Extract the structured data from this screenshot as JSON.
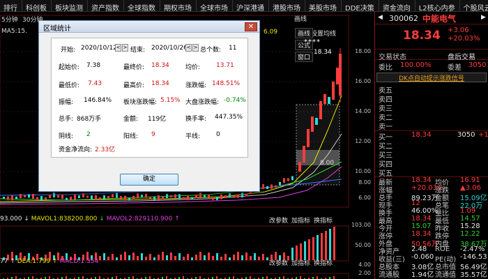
{
  "topbar": {
    "items": [
      "排行",
      "科创板",
      "板块监测",
      "资产指数",
      "全球指数",
      "期权市场",
      "全球市场",
      "沪深港通",
      "港股市场",
      "美股市场",
      "DDE决策",
      "资金流向",
      "L2核心内参",
      "个股风云"
    ]
  },
  "chart": {
    "period_label": "5分钟",
    "period_label_2": "30分钟",
    "ma5_label": "MA5:15.",
    "top_value": "6.09",
    "settings_label": "设置均线",
    "tabs": [
      "画线",
      "公式",
      "窗口"
    ],
    "peak_label": "18.34",
    "stars": "****",
    "range_label": "8.00",
    "price_ticks": [
      "18.00",
      "16.00",
      "14.00",
      "12.00",
      "10.00",
      "8.00",
      "6.00"
    ],
    "vol_line": {
      "prefix": "93.000",
      "mavol1_label": "MAVOL1:838200.800",
      "mavol2_label": "MAVOL2:829110.900"
    },
    "vol_buttons": [
      "改参数",
      "加指标",
      "换指标"
    ],
    "vol_ticks": [
      "103.00",
      "50.00"
    ],
    "macd_line": {
      "prefix": "77",
      "dea_label": "DEA:1.799",
      "macd_label": "MACD:1.354"
    },
    "macd_buttons": [
      "改参数",
      "加指标",
      "换指标"
    ],
    "macd_ticks": [
      "4.00",
      "2.00"
    ]
  },
  "dialog": {
    "title": "区域统计",
    "close": "✕",
    "start_label": "开始:",
    "start_value": "2020/10/12",
    "end_label": "结束:",
    "end_value": "2020/10/26",
    "count_label": "总个数:",
    "count_value": "11",
    "open_label": "起始价:",
    "open_value": "7.38",
    "last_label": "最终价:",
    "last_value": "18.34",
    "avg_label": "均价:",
    "avg_value": "13.71",
    "low_label": "最低价:",
    "low_value": "7.43",
    "high_label": "最高价:",
    "high_value": "18.34",
    "chg_label": "涨跌幅:",
    "chg_value": "148.51%",
    "amp_label": "振幅:",
    "amp_value": "146.84%",
    "sector_label": "板块涨跌幅:",
    "sector_value": "5.15%",
    "market_label": "大盘涨跌幅:",
    "market_value": "-0.74%",
    "vol_label": "总手:",
    "vol_value": "868万手",
    "amt_label": "金额:",
    "amt_value": "119亿",
    "turn_label": "换手率:",
    "turn_value": "447.35%",
    "yin_label": "阴线:",
    "yin_value": "2",
    "yang_label": "阳线:",
    "yang_value": "9",
    "flat_label": "平线:",
    "flat_value": "0",
    "flow_label": "资金净流向:",
    "flow_value": "2.33亿",
    "ok_label": "确定"
  },
  "quote": {
    "code": "300062",
    "name": "中能电气",
    "price": "18.34",
    "change": "+3.06",
    "change_pct": "+20.03%",
    "state_label": "交易状态",
    "state_value": "盘后交易",
    "bid_ratio_label": "委比",
    "bid_ratio_value": "100.00%",
    "bid_diff_label": "委差",
    "bid_diff_value": "3050",
    "banner": "DK点自动提示涨跌信号",
    "asks": [
      {
        "label": "卖五",
        "price": "",
        "vol": ""
      },
      {
        "label": "卖四",
        "price": "",
        "vol": ""
      },
      {
        "label": "卖三",
        "price": "",
        "vol": ""
      },
      {
        "label": "卖二",
        "price": "",
        "vol": ""
      },
      {
        "label": "卖一",
        "price": "",
        "vol": ""
      }
    ],
    "bids": [
      {
        "label": "买一",
        "price": "18.34",
        "vol": "3050",
        "chg": "+1"
      },
      {
        "label": "买二",
        "price": "",
        "vol": "",
        "chg": ""
      },
      {
        "label": "买三",
        "price": "",
        "vol": "",
        "chg": ""
      },
      {
        "label": "买四",
        "price": "",
        "vol": "",
        "chg": ""
      },
      {
        "label": "买五",
        "price": "",
        "vol": "",
        "chg": ""
      }
    ],
    "stats": [
      {
        "l1": "最新",
        "v1": "18.34",
        "c1": "red",
        "l2": "均价",
        "v2": "16.91",
        "c2": "red"
      },
      {
        "l1": "涨幅",
        "v1": "+20.03%",
        "c1": "red",
        "l2": "涨跌",
        "v2": "▲3.06",
        "c2": "red"
      },
      {
        "l1": "总手",
        "v1": "89.23万",
        "c1": "white",
        "l2": "金额",
        "v2": "15.09亿",
        "c2": "cyan"
      },
      {
        "l1": "现手",
        "v1": "12",
        "c1": "red",
        "l2": "总笔",
        "v2": "22.0万",
        "c2": "cyan"
      },
      {
        "l1": "换手",
        "v1": "46.00%",
        "c1": "white",
        "l2": "量比",
        "v2": "1.09",
        "c2": "red"
      },
      {
        "l1": "最高",
        "v1": "18.34",
        "c1": "red",
        "l2": "最低",
        "v2": "14.57",
        "c2": "green"
      },
      {
        "l1": "今开",
        "v1": "15.07",
        "c1": "green",
        "l2": "昨收",
        "v2": "15.28",
        "c2": "white"
      },
      {
        "l1": "涨停",
        "v1": "18.34",
        "c1": "red",
        "l2": "跌停",
        "v2": "12.22",
        "c2": "green"
      },
      {
        "l1": "外盘",
        "v1": "50.56万",
        "c1": "red",
        "l2": "内盘",
        "v2": "38.67万",
        "c2": "green"
      },
      {
        "l1": "净资产",
        "v1": "2.48",
        "c1": "white",
        "l2": "ROE",
        "v2": "-2.47%",
        "c2": "white"
      },
      {
        "l1": "收益(三)",
        "v1": "-0.060",
        "c1": "white",
        "l2": "PE(动)",
        "v2": "-146.53",
        "c2": "white"
      },
      {
        "l1": "总股本",
        "v1": "3.08亿",
        "c1": "white",
        "l2": "总市值",
        "v2": "56.49亿",
        "c2": "white"
      },
      {
        "l1": "流通股",
        "v1": "1.94亿",
        "c1": "white",
        "l2": "流通值",
        "v2": "35.57亿",
        "c2": "white"
      }
    ]
  }
}
